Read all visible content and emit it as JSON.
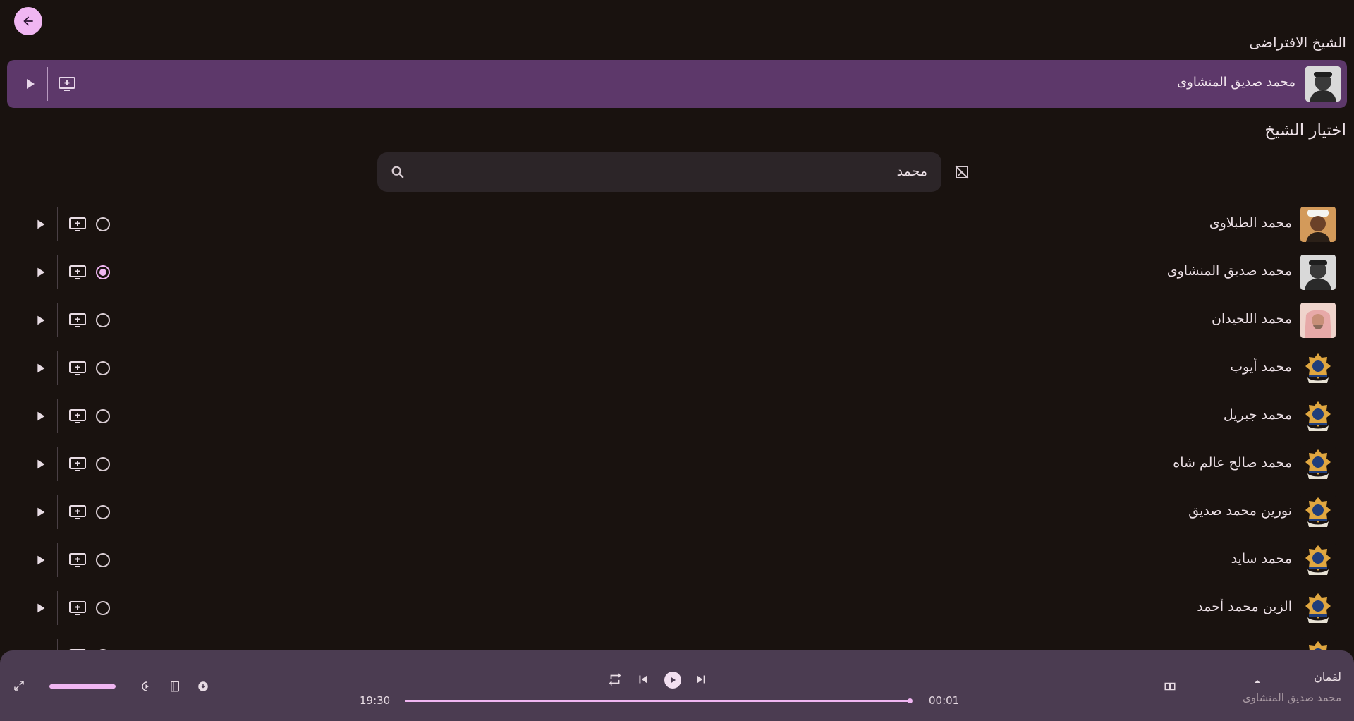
{
  "header": {
    "back_icon": "arrow-left-icon"
  },
  "default_section": {
    "title": "الشيخ الافتراضى",
    "reciter_name": "محمد صديق المنشاوى",
    "avatar": "reciter-photo-minshawi"
  },
  "choose_section": {
    "title": "اختيار الشيخ"
  },
  "search": {
    "query": "محمد",
    "icon": "search-icon",
    "toggle_icon": "hide-image-icon"
  },
  "reciters": [
    {
      "name": "محمد الطبلاوى",
      "selected": false,
      "avatar": "photo"
    },
    {
      "name": "محمد صديق المنشاوى",
      "selected": true,
      "avatar": "photo"
    },
    {
      "name": "محمد اللحيدان",
      "selected": false,
      "avatar": "photo"
    },
    {
      "name": "محمد أيوب",
      "selected": false,
      "avatar": "emblem"
    },
    {
      "name": "محمد جبريل",
      "selected": false,
      "avatar": "emblem"
    },
    {
      "name": "محمد صالح عالم شاه",
      "selected": false,
      "avatar": "emblem"
    },
    {
      "name": "نورين محمد صديق",
      "selected": false,
      "avatar": "emblem"
    },
    {
      "name": "محمد سايد",
      "selected": false,
      "avatar": "emblem"
    },
    {
      "name": "الزين محمد أحمد",
      "selected": false,
      "avatar": "emblem"
    },
    {
      "name": "",
      "selected": false,
      "avatar": "emblem"
    }
  ],
  "player": {
    "surah": "لقمان",
    "reciter": "محمد صديق المنشاوى",
    "elapsed": "00:01",
    "total": "19:30",
    "progress": 0.999,
    "volume": 1.0,
    "icons": [
      "expand-icon",
      "speed-icon",
      "book-icon",
      "download-icon",
      "repeat-icon",
      "skip-previous-icon",
      "play-icon",
      "skip-next-icon",
      "chevron-up-icon",
      "reading-icon"
    ]
  },
  "colors": {
    "background": "#19120f",
    "accent": "#f0b6f2",
    "card": "#5d386a",
    "player": "#4b3c51"
  }
}
